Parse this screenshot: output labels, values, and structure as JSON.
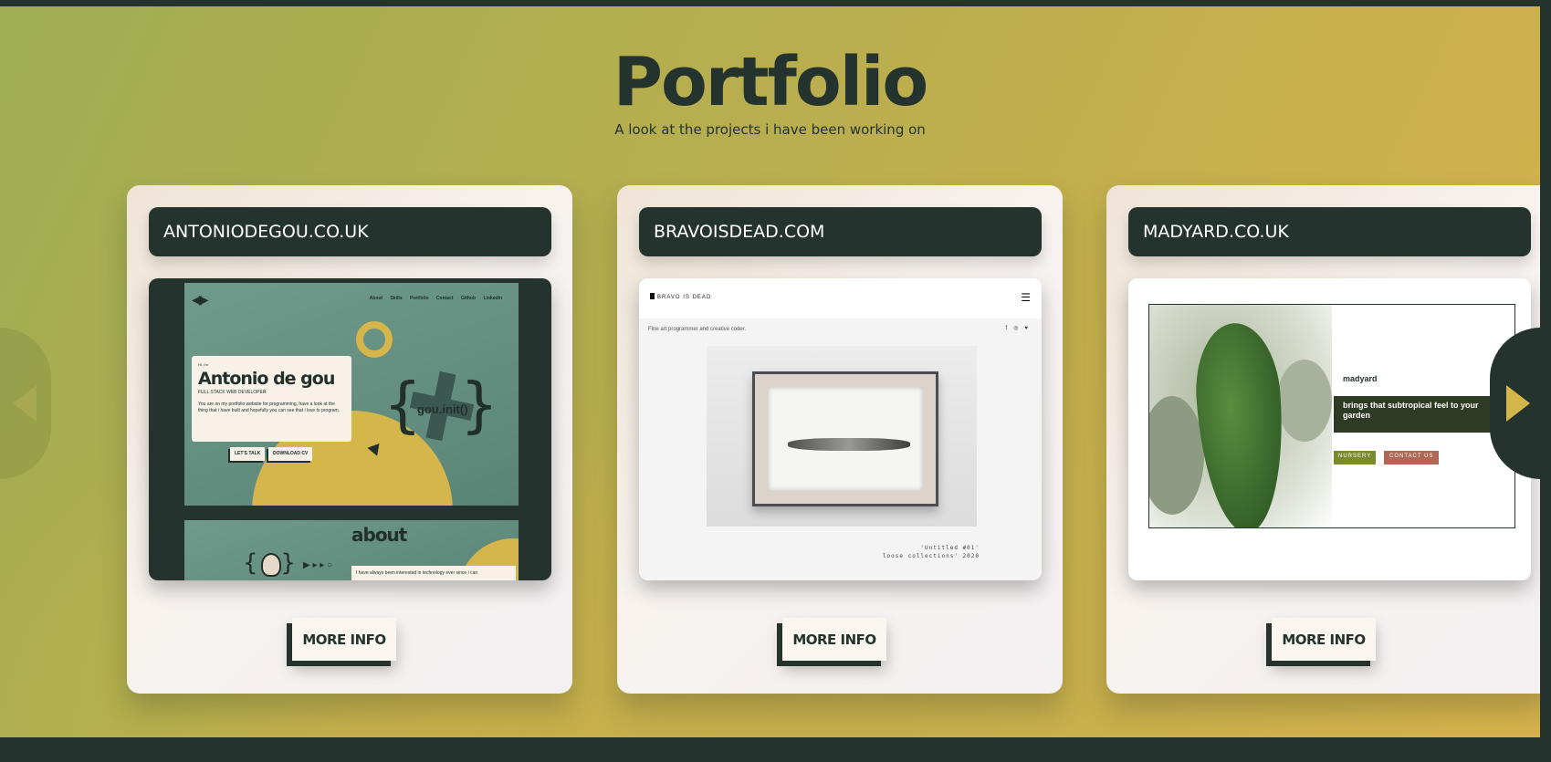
{
  "header": {
    "title": "Portfolio",
    "subtitle": "A look at the projects i have been working on"
  },
  "cards": [
    {
      "title": "ANTONIODEGOU.CO.UK",
      "button": "MORE INFO",
      "preview": {
        "nav": [
          "About",
          "Skills",
          "Portfolio",
          "Contact",
          "Github",
          "LinkedIn"
        ],
        "greeting": "Hi, i'm",
        "name": "Antonio de gou",
        "role": "FULL STACK WEB DEVELOPER",
        "body": "You are on my portfolio website for programming, have a look at the thing that i have built and hopefully you can see that i love to program.",
        "btn_talk": "LET'S TALK",
        "btn_cv": "DOWNLOAD CV",
        "code": "gou.init()",
        "about": "about",
        "about_text": "I have always been interested in technology ever since i can"
      }
    },
    {
      "title": "BRAVOISDEAD.COM",
      "button": "MORE INFO",
      "preview": {
        "brand": "BRAVO IS DEAD",
        "tagline": "Fine art programmer and creative coder.",
        "caption_line1": "'Untitled #01'",
        "caption_line2": "loose collections' 2020"
      }
    },
    {
      "title": "MADYARD.CO.UK",
      "button": "MORE INFO",
      "preview": {
        "brand": "madyard",
        "headline": "brings that subtropical feel to your garden",
        "btn_nursery": "NURSERY",
        "btn_contact": "CONTACT US"
      }
    }
  ],
  "nav": {
    "prev_icon": "arrow-left-icon",
    "next_icon": "arrow-right-icon"
  },
  "colors": {
    "dark": "#24332d",
    "accent": "#d5b64a",
    "olive": "#9fae52"
  }
}
